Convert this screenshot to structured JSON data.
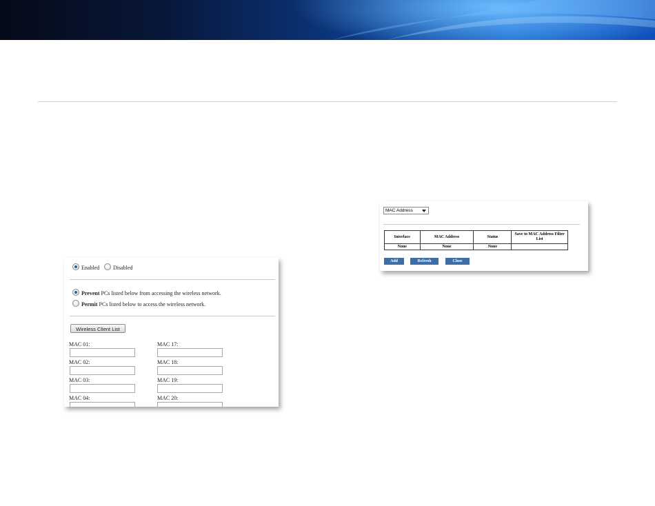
{
  "wireless_mac_filter": {
    "enabled_label": "Enabled",
    "disabled_label": "Disabled",
    "enabled_selected": true,
    "prevent_bold": "Prevent",
    "prevent_rest": "PCs listed below from accessing the wireless network.",
    "permit_bold": "Permit",
    "permit_rest": "PCs listed below to access the wireless network.",
    "prevent_selected": true,
    "client_list_button": "Wireless Client List",
    "mac_labels_left": [
      "MAC 01:",
      "MAC 02:",
      "MAC 03:",
      "MAC 04:"
    ],
    "mac_labels_right": [
      "MAC 17:",
      "MAC 18:",
      "MAC 19:",
      "MAC 20:"
    ]
  },
  "client_list": {
    "sort_select": "MAC Address",
    "columns": [
      "Interface",
      "MAC Address",
      "Status",
      "Save to MAC Address Filter List"
    ],
    "rows": [
      [
        "None",
        "None",
        "None",
        ""
      ]
    ],
    "buttons": {
      "add": "Add",
      "refresh": "Refresh",
      "close": "Close"
    }
  },
  "colors": {
    "accent_button": "#3e6ea8",
    "radio_selected": "#1f5fa8"
  }
}
